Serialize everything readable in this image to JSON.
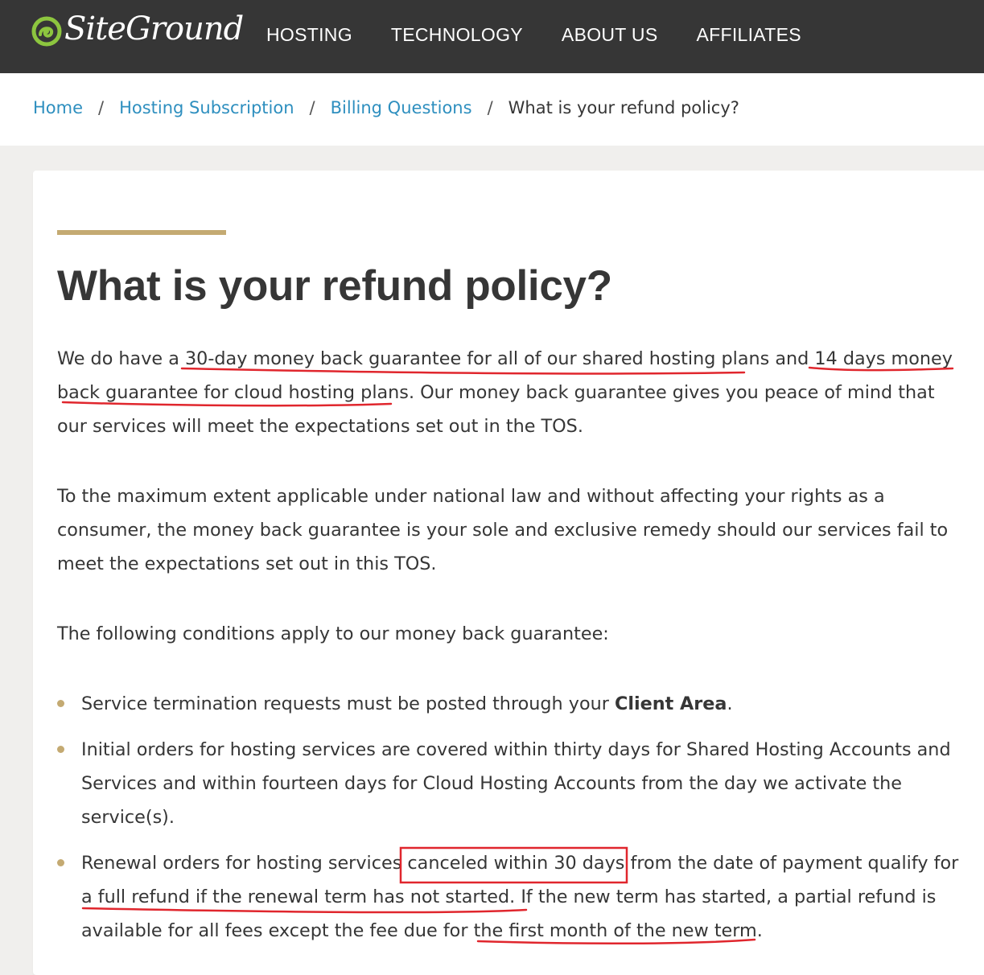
{
  "brand": {
    "name": "SiteGround",
    "logo_icon": "siteground-swirl-icon"
  },
  "nav": {
    "items": [
      {
        "label": "HOSTING"
      },
      {
        "label": "TECHNOLOGY"
      },
      {
        "label": "ABOUT US"
      },
      {
        "label": "AFFILIATES"
      }
    ]
  },
  "breadcrumb": {
    "items": [
      {
        "label": "Home"
      },
      {
        "label": "Hosting Subscription"
      },
      {
        "label": "Billing Questions"
      }
    ],
    "separator": "/",
    "current": "What is your refund policy?"
  },
  "article": {
    "title": "What is your refund policy?",
    "p1": {
      "a": "We do have a ",
      "b": "30-day money back guarantee for all of our shared hosting plans",
      "c": " and ",
      "d": "14 days money back guarantee for cloud hosting plans",
      "e": ". Our money back guarantee gives you peace of mind that our services will meet the expectations set out in the TOS."
    },
    "p2": "To the maximum extent applicable under national law and without affecting your rights as a consumer, the money back guarantee is your sole and exclusive remedy should our services fail to meet the expectations set out in this TOS.",
    "p3": "The following conditions apply to our money back guarantee:",
    "conditions": [
      {
        "before": "Service termination requests must be posted through your ",
        "strong": "Client Area",
        "after": "."
      },
      {
        "text": "Initial orders for hosting services are covered within thirty days for Shared Hosting Accounts and Services and within fourteen days for Cloud Hosting Accounts from the day we activate the service(s)."
      },
      {
        "a": "Renewal orders for hosting services ",
        "b": "canceled within 30 days",
        "c": " from the date of payment qualify for ",
        "d": "a full refund if the renewal term has not started",
        "e": ". If the new term has started, a partial refund is available for all fees except the fee due for ",
        "f": "the first month of the new term",
        "g": "."
      }
    ]
  },
  "colors": {
    "topbar": "#363636",
    "link": "#2e8fbf",
    "accent": "#c4aa72",
    "text": "#363636",
    "annotation": "#e0262d",
    "logo_green": "#8dc63f"
  }
}
